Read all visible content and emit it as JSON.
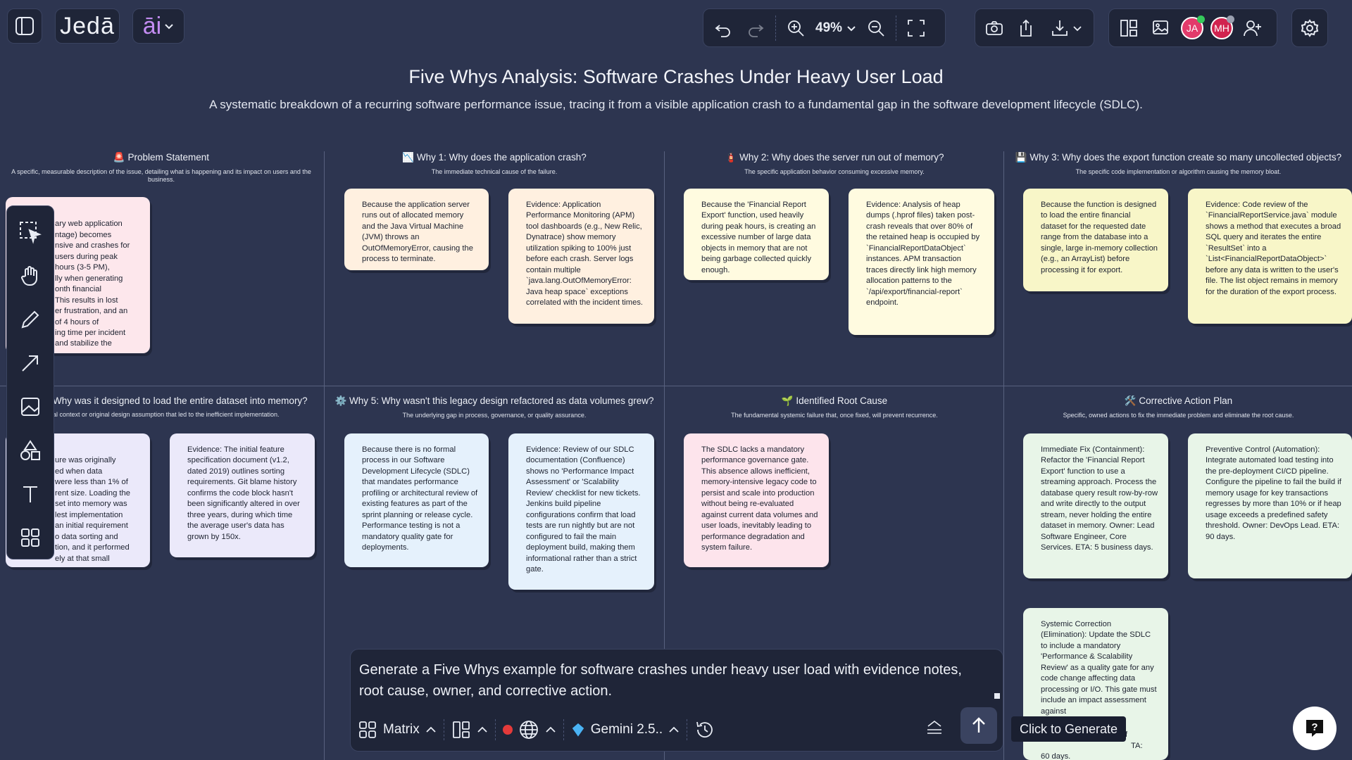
{
  "app": {
    "logo": "Jedā",
    "ai_label": "āi",
    "zoom": "49%"
  },
  "users": [
    {
      "initials": "JA",
      "color": "#e23b6b",
      "status_color": "#35c95b"
    },
    {
      "initials": "MH",
      "color": "#d1234f",
      "status_color": "#9aa0b0"
    }
  ],
  "board": {
    "title": "Five Whys Analysis: Software Crashes Under Heavy User Load",
    "subtitle": "A systematic breakdown of a recurring software performance issue, tracing it from a visible application crash to a fundamental gap in the software development lifecycle (SDLC).",
    "columns": [
      {
        "icon": "🚨",
        "title": "Problem Statement",
        "desc": "A specific, measurable description of the issue, detailing what is happening and its impact on users and the business."
      },
      {
        "icon": "📉",
        "title": "Why 1: Why does the application crash?",
        "desc": "The immediate technical cause of the failure."
      },
      {
        "icon": "🧯",
        "title": "Why 2: Why does the server run out of memory?",
        "desc": "The specific application behavior consuming excessive memory."
      },
      {
        "icon": "💾",
        "title": "Why 3: Why does the export function create so many uncollected objects?",
        "desc": "The specific code implementation or algorithm causing the memory bloat."
      },
      {
        "icon": "",
        "title": "Why was it designed to load the entire dataset into memory?",
        "desc": "al context or original design assumption that led to the inefficient implementation."
      },
      {
        "icon": "⚙️",
        "title": "Why 5: Why wasn't this legacy design refactored as data volumes grew?",
        "desc": "The underlying gap in process, governance, or quality assurance."
      },
      {
        "icon": "🌱",
        "title": "Identified Root Cause",
        "desc": "The fundamental systemic failure that, once fixed, will prevent recurrence."
      },
      {
        "icon": "🛠️",
        "title": "Corrective Action Plan",
        "desc": "Specific, owned actions to fix the immediate problem and eliminate the root cause."
      }
    ],
    "cards": {
      "problem": "ary web application\nntage) becomes\nnsive and crashes for\n users during peak\n hours (3-5 PM),\nlly when generating\nonth financial\n This results in lost\ner frustration, and an\n of 4 hours of\ning time per incident\n and stabilize the",
      "why1_cause": "Because the application server runs out of allocated memory and the Java Virtual Machine (JVM) throws an OutOfMemoryError, causing the process to terminate.",
      "why1_evidence": "Evidence: Application Performance Monitoring (APM) tool dashboards (e.g., New Relic, Dynatrace) show memory utilization spiking to 100% just before each crash. Server logs contain multiple `java.lang.OutOfMemoryError: Java heap space` exceptions correlated with the incident times.",
      "why2_cause": "Because the 'Financial Report Export' function, used heavily during peak hours, is creating an excessive number of large data objects in memory that are not being garbage collected quickly enough.",
      "why2_evidence": "Evidence: Analysis of heap dumps (.hprof files) taken post-crash reveals that over 80% of the retained heap is occupied by `FinancialReportDataObject` instances. APM transaction traces directly link high memory allocation patterns to the `/api/export/financial-report` endpoint.",
      "why3_cause": "Because the function is designed to load the entire financial dataset for the requested date range from the database into a single, large in-memory collection (e.g., an ArrayList) before processing it for export.",
      "why3_evidence": "Evidence: Code review of the `FinancialReportService.java` module shows a method that executes a broad SQL query and iterates the entire `ResultSet` into a `List<FinancialReportDataObject>` before any data is written to the user's file. The list object remains in memory for the duration of the export process.",
      "why4_cause": "ure was originally\ned when data\n were less than 1% of\nrent size. Loading the\nset into memory was\nlest implementation\nan initial requirement\no data sorting and\ntion, and it performed\nely at that small",
      "why4_evidence": "Evidence: The initial feature specification document (v1.2, dated 2019) outlines sorting requirements. Git blame history confirms the code block hasn't been significantly altered in over three years, during which time the average user's data has grown by 150x.",
      "why5_cause": "Because there is no formal process in our Software Development Lifecycle (SDLC) that mandates performance profiling or architectural review of existing features as part of the sprint planning or release cycle. Performance testing is not a mandatory quality gate for deployments.",
      "why5_evidence": "Evidence: Review of our SDLC documentation (Confluence) shows no 'Performance Impact Assessment' or 'Scalability Review' checklist for new tickets. Jenkins build pipeline configurations confirm that load tests are run nightly but are not configured to fail the main deployment build, making them informational rather than a strict gate.",
      "root_cause": "The SDLC lacks a mandatory performance governance gate. This absence allows inefficient, memory-intensive legacy code to persist and scale into production without being re-evaluated against current data volumes and user loads, inevitably leading to performance degradation and system failure.",
      "action1": "Immediate Fix (Containment): Refactor the 'Financial Report Export' function to use a streaming approach. Process the database query result row-by-row and write directly to the output stream, never holding the entire dataset in memory. Owner: Lead Software Engineer, Core Services. ETA: 5 business days.",
      "action2": "Preventive Control (Automation): Integrate automated load testing into the pre-deployment CI/CD pipeline. Configure the pipeline to fail the build if memory usage for key transactions regresses by more than 10% or if heap usage exceeds a predefined safety threshold. Owner: DevOps Lead. ETA: 90 days.",
      "action3": "Systemic Correction (Elimination): Update the SDLC to include a mandatory 'Performance & Scalability Review' as a quality gate for any code change affecting data processing or I/O. This gate must include an impact assessment against",
      "action3_tail_1": "f",
      "action3_tail_2": "TA:",
      "action3_tail_3": "60 days."
    }
  },
  "prompt": {
    "text": "Generate a Five Whys example for software crashes under heavy user load with evidence notes, root cause, owner, and corrective action.",
    "layout_label": "Matrix",
    "model_label": "Gemini 2.5..",
    "tooltip": "Click to Generate"
  }
}
